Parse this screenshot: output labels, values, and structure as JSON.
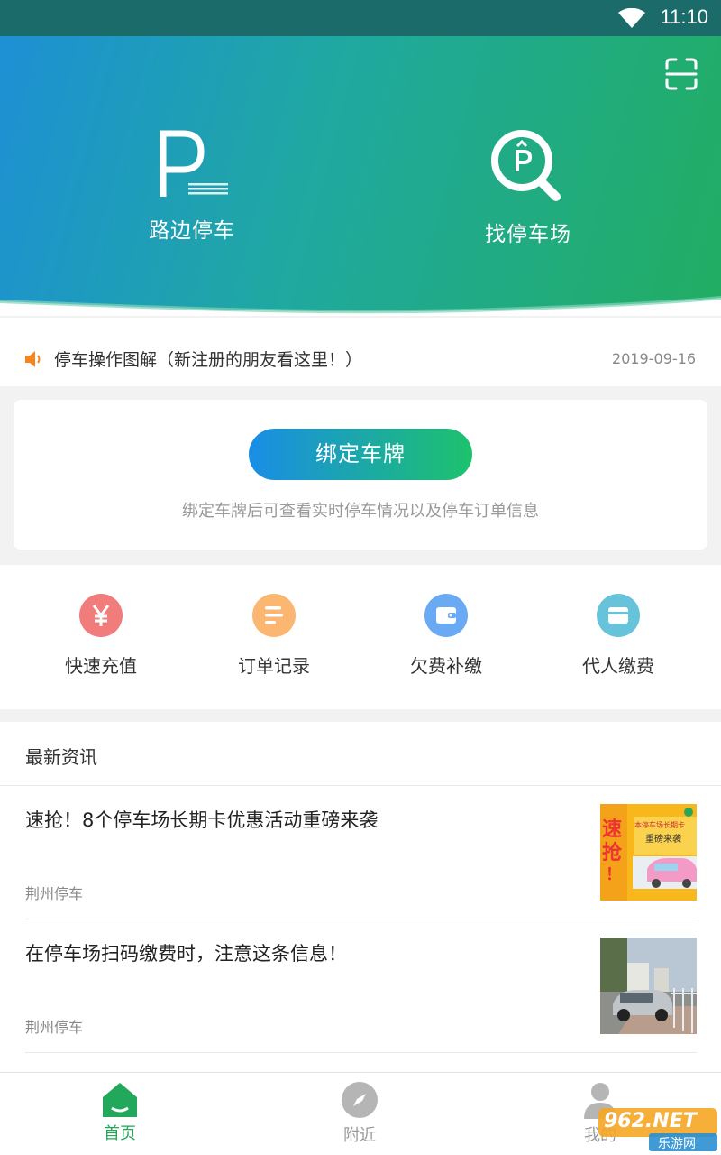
{
  "status_bar": {
    "time": "11:10"
  },
  "hero": {
    "actions": [
      {
        "label": "路边停车",
        "icon": "parking-p-icon"
      },
      {
        "label": "找停车场",
        "icon": "parking-search-icon"
      }
    ],
    "scan_icon": "scan-icon",
    "gradient": [
      "#1e8fd6",
      "#22ad62"
    ]
  },
  "notice": {
    "text": "停车操作图解（新注册的朋友看这里！）",
    "date": "2019-09-16",
    "icon": "speaker-icon",
    "icon_color": "#f5861f"
  },
  "bind_card": {
    "button_label": "绑定车牌",
    "hint": "绑定车牌后可查看实时停车情况以及停车订单信息"
  },
  "quick_actions": [
    {
      "label": "快速充值",
      "icon": "yuan-icon",
      "color": "#f07c7c"
    },
    {
      "label": "订单记录",
      "icon": "list-icon",
      "color": "#fbb771"
    },
    {
      "label": "欠费补缴",
      "icon": "wallet-icon",
      "color": "#6aa9f3"
    },
    {
      "label": "代人缴费",
      "icon": "card-icon",
      "color": "#66c3d9"
    }
  ],
  "news": {
    "heading": "最新资讯",
    "items": [
      {
        "title": "速抢！8个停车场长期卡优惠活动重磅来袭",
        "source": "荆州停车",
        "thumb_text": [
          "速",
          "抢",
          "！",
          "本停车场长期卡",
          "重磅来袭"
        ]
      },
      {
        "title": "在停车场扫码缴费时，注意这条信息！",
        "source": "荆州停车"
      }
    ]
  },
  "bottom_nav": {
    "items": [
      {
        "label": "首页",
        "icon": "home-icon",
        "active": true
      },
      {
        "label": "附近",
        "icon": "compass-icon",
        "active": false
      },
      {
        "label": "我的",
        "icon": "user-icon",
        "active": false
      }
    ],
    "active_color": "#22a85a",
    "inactive_color": "#999999"
  },
  "watermark": {
    "text": "962.NET",
    "subtext": "乐游网"
  }
}
